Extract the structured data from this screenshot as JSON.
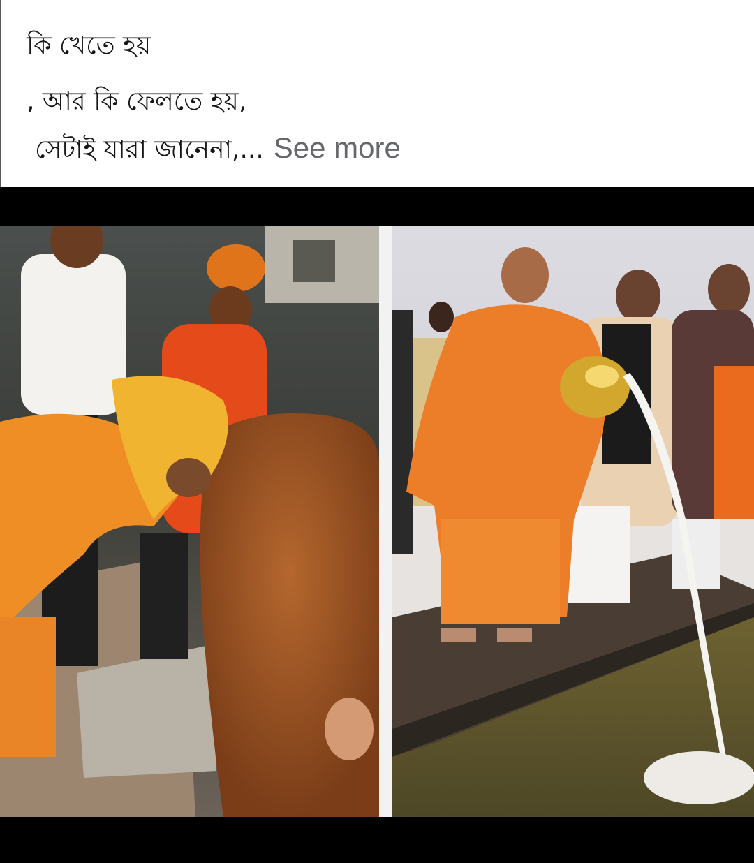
{
  "post": {
    "caption_line_1": "কি খেতে হয়",
    "caption_line_2": ", আর কি ফেলতে হয়,",
    "caption_line_3": "সেটাই যারা জানেনা,...",
    "see_more_label": "See more"
  },
  "media": {
    "left_photo": "man in orange robe with yellow headscarf bent over a brown cow, onlookers behind",
    "right_photo": "monk in saffron robes pouring milk from a brass pot into river water from a wooden jetty, men in kurtas beside him"
  },
  "colors": {
    "caption_text": "#151515",
    "see_more": "#65676b",
    "background": "#000000"
  }
}
